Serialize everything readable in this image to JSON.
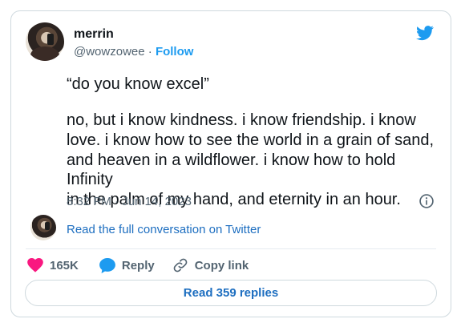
{
  "user": {
    "name": "merrin",
    "handle": "@wowzowee",
    "separator": "·",
    "follow_label": "Follow"
  },
  "tweet": {
    "quote": "“do you know excel”",
    "lines": [
      "no, but i know kindness. i know friendship. i know",
      "love. i know how to see the world in a grain of sand,",
      "and heaven in a wildflower. i know how to hold Infinity",
      "in the palm of my hand, and eternity in an hour."
    ],
    "timestamp": "8:32 PM · Jun 14, 2023"
  },
  "conversation_link": "Read the full conversation on Twitter",
  "actions": {
    "likes": "165K",
    "reply_label": "Reply",
    "copy_link_label": "Copy link"
  },
  "read_replies_label": "Read 359 replies",
  "colors": {
    "brand": "#1d9bf0",
    "like": "#f91880",
    "link": "#1d6ec0",
    "muted": "#536471"
  },
  "icons": [
    "twitter-bird-icon",
    "info-icon",
    "heart-icon",
    "reply-bubble-icon",
    "link-icon"
  ]
}
